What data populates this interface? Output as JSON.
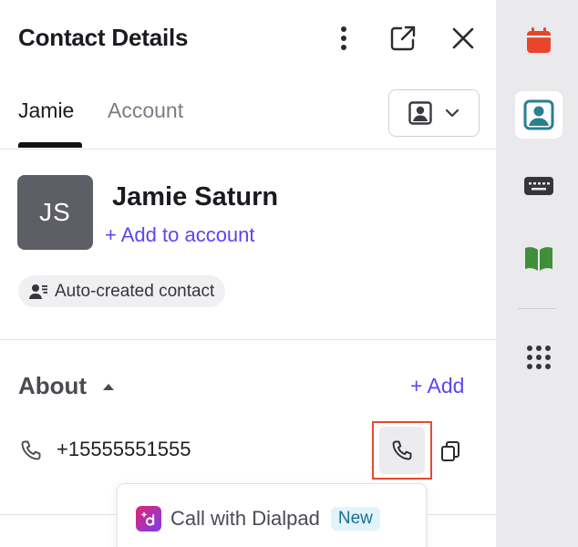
{
  "header": {
    "title": "Contact Details",
    "more_icon": "more-vertical-icon",
    "open_icon": "external-link-icon",
    "close_icon": "close-icon"
  },
  "tabs": [
    {
      "label": "Jamie",
      "active": true
    },
    {
      "label": "Account",
      "active": false
    }
  ],
  "view_select": {
    "icon": "contact-card-icon",
    "caret_icon": "chevron-down-icon"
  },
  "contact": {
    "initials": "JS",
    "name": "Jamie Saturn",
    "add_to_account": "+ Add to account",
    "chip_label": "Auto-created contact"
  },
  "about": {
    "title": "About",
    "add_label": "+ Add",
    "phone": "+15555551555"
  },
  "tooltip": {
    "label": "Call with Dialpad",
    "badge": "New"
  },
  "rail": {
    "items": [
      "calendar-icon",
      "contact-card-icon",
      "keyboard-icon",
      "book-icon",
      "apps-grid-icon"
    ]
  },
  "colors": {
    "accent": "#5b46f2",
    "highlight_outline": "#e64a2e",
    "calendar": "#e8452c",
    "contact_active": "#2a7f8f",
    "book": "#3f8f3a"
  }
}
